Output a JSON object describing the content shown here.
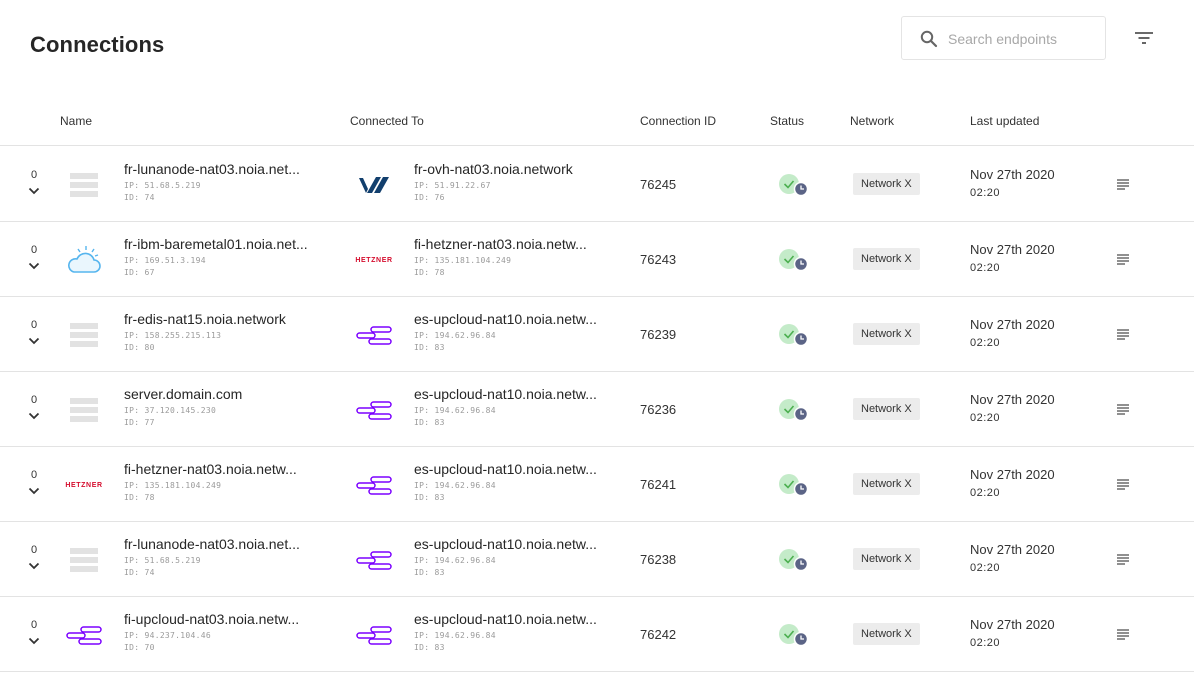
{
  "page": {
    "title": "Connections"
  },
  "search": {
    "placeholder": "Search endpoints",
    "value": ""
  },
  "columns": {
    "name": "Name",
    "connected_to": "Connected To",
    "connection_id": "Connection ID",
    "status": "Status",
    "network": "Network",
    "last_updated": "Last updated"
  },
  "colors": {
    "status_ok": "#c4ebc9",
    "status_check": "#4caf50",
    "status_clock": "#5b6486",
    "ovh": "#123f6d",
    "hetzner": "#d50c2d",
    "upcloud": "#7b00ff",
    "ibm_cloud": "#56b5ee",
    "generic": "#e2e2e2"
  },
  "rows": [
    {
      "count": "0",
      "name": {
        "logo": "server-stack-icon",
        "title": "fr-lunanode-nat03.noia.net...",
        "ip": "IP: 51.68.5.219",
        "id": "ID: 74"
      },
      "connected": {
        "logo": "ovh-logo",
        "title": "fr-ovh-nat03.noia.network",
        "ip": "IP: 51.91.22.67",
        "id": "ID: 76"
      },
      "connection_id": "76245",
      "network": "Network X",
      "date": "Nov 27th 2020",
      "time": "02:20"
    },
    {
      "count": "0",
      "name": {
        "logo": "ibm-cloud-icon",
        "title": "fr-ibm-baremetal01.noia.net...",
        "ip": "IP: 169.51.3.194",
        "id": "ID: 67"
      },
      "connected": {
        "logo": "hetzner-logo",
        "title": "fi-hetzner-nat03.noia.netw...",
        "ip": "IP: 135.181.104.249",
        "id": "ID: 78"
      },
      "connection_id": "76243",
      "network": "Network X",
      "date": "Nov 27th 2020",
      "time": "02:20"
    },
    {
      "count": "0",
      "name": {
        "logo": "server-stack-icon",
        "title": "fr-edis-nat15.noia.network",
        "ip": "IP: 158.255.215.113",
        "id": "ID: 80"
      },
      "connected": {
        "logo": "upcloud-logo",
        "title": "es-upcloud-nat10.noia.netw...",
        "ip": "IP: 194.62.96.84",
        "id": "ID: 83"
      },
      "connection_id": "76239",
      "network": "Network X",
      "date": "Nov 27th 2020",
      "time": "02:20"
    },
    {
      "count": "0",
      "name": {
        "logo": "server-stack-icon",
        "title": "server.domain.com",
        "ip": "IP: 37.120.145.230",
        "id": "ID: 77"
      },
      "connected": {
        "logo": "upcloud-logo",
        "title": "es-upcloud-nat10.noia.netw...",
        "ip": "IP: 194.62.96.84",
        "id": "ID: 83"
      },
      "connection_id": "76236",
      "network": "Network X",
      "date": "Nov 27th 2020",
      "time": "02:20"
    },
    {
      "count": "0",
      "name": {
        "logo": "hetzner-logo",
        "title": "fi-hetzner-nat03.noia.netw...",
        "ip": "IP: 135.181.104.249",
        "id": "ID: 78"
      },
      "connected": {
        "logo": "upcloud-logo",
        "title": "es-upcloud-nat10.noia.netw...",
        "ip": "IP: 194.62.96.84",
        "id": "ID: 83"
      },
      "connection_id": "76241",
      "network": "Network X",
      "date": "Nov 27th 2020",
      "time": "02:20"
    },
    {
      "count": "0",
      "name": {
        "logo": "server-stack-icon",
        "title": "fr-lunanode-nat03.noia.net...",
        "ip": "IP: 51.68.5.219",
        "id": "ID: 74"
      },
      "connected": {
        "logo": "upcloud-logo",
        "title": "es-upcloud-nat10.noia.netw...",
        "ip": "IP: 194.62.96.84",
        "id": "ID: 83"
      },
      "connection_id": "76238",
      "network": "Network X",
      "date": "Nov 27th 2020",
      "time": "02:20"
    },
    {
      "count": "0",
      "name": {
        "logo": "upcloud-logo",
        "title": "fi-upcloud-nat03.noia.netw...",
        "ip": "IP: 94.237.104.46",
        "id": "ID: 70"
      },
      "connected": {
        "logo": "upcloud-logo",
        "title": "es-upcloud-nat10.noia.netw...",
        "ip": "IP: 194.62.96.84",
        "id": "ID: 83"
      },
      "connection_id": "76242",
      "network": "Network X",
      "date": "Nov 27th 2020",
      "time": "02:20"
    }
  ],
  "logo_text": {
    "hetzner": "HETZNER"
  }
}
